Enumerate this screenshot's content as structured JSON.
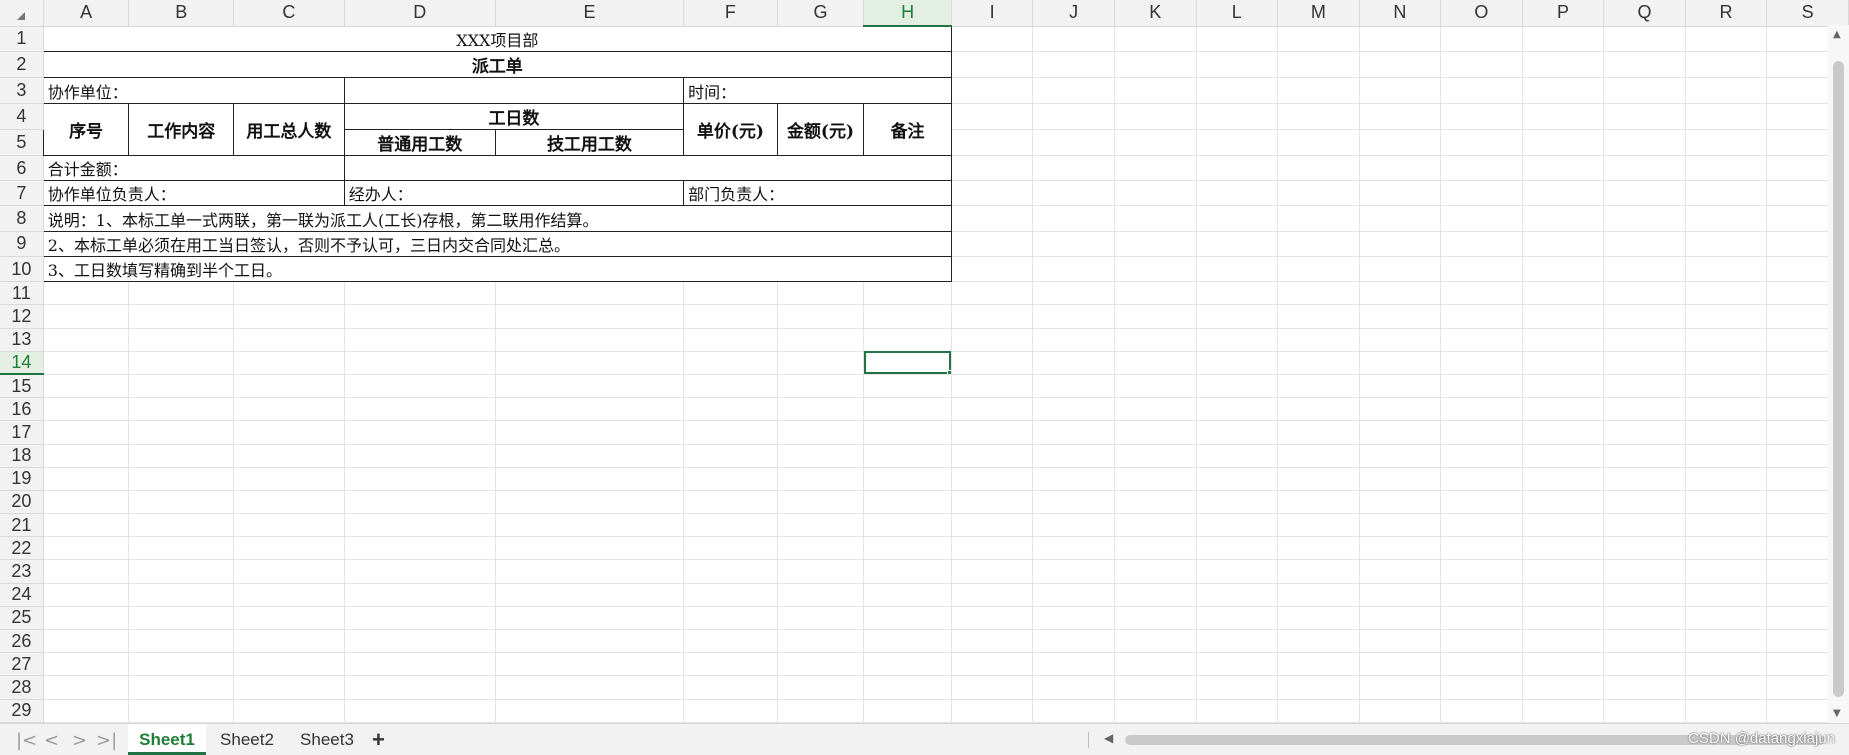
{
  "columns": [
    "A",
    "B",
    "C",
    "D",
    "E",
    "F",
    "G",
    "H",
    "I",
    "J",
    "K",
    "L",
    "M",
    "N",
    "O",
    "P",
    "Q",
    "R",
    "S"
  ],
  "active_column": "H",
  "active_row": "14",
  "rows": [
    "1",
    "2",
    "3",
    "4",
    "5",
    "6",
    "7",
    "8",
    "9",
    "10",
    "11",
    "12",
    "13",
    "14",
    "15",
    "16",
    "17",
    "18",
    "19",
    "20",
    "21",
    "22",
    "23",
    "24",
    "25",
    "26",
    "27",
    "28",
    "29"
  ],
  "cells": {
    "r1": "XXX项目部",
    "r2": "派工单",
    "r3_a": "协作单位：",
    "r3_f": "时间：",
    "r4_a": "序号",
    "r4_b": "工作内容",
    "r4_c": "用工总人数",
    "r4_d": "工日数",
    "r4_f": "单价(元)",
    "r4_g": "金额(元)",
    "r4_h": "备注",
    "r5_d": "普通用工数",
    "r5_e": "技工用工数",
    "r6_a": "合计金额：",
    "r7_a": "协作单位负责人：",
    "r7_d": "经办人：",
    "r7_f": "部门负责人：",
    "r8": "说明：1、本标工单一式两联，第一联为派工人(工长)存根，第二联用作结算。",
    "r9": "2、本标工单必须在用工当日签认，否则不予认可，三日内交合同处汇总。",
    "r10": "3、工日数填写精确到半个工日。"
  },
  "sheets": [
    "Sheet1",
    "Sheet2",
    "Sheet3"
  ],
  "active_sheet": "Sheet1",
  "add_sheet": "+",
  "nav": {
    "first": "|<",
    "prev": "<",
    "next": ">",
    "last": ">|"
  },
  "watermark": "CSDN @datangxiajun",
  "colors": {
    "accent": "#217346",
    "header_bg": "#f2f2f2",
    "grid": "#e4e4e4"
  }
}
